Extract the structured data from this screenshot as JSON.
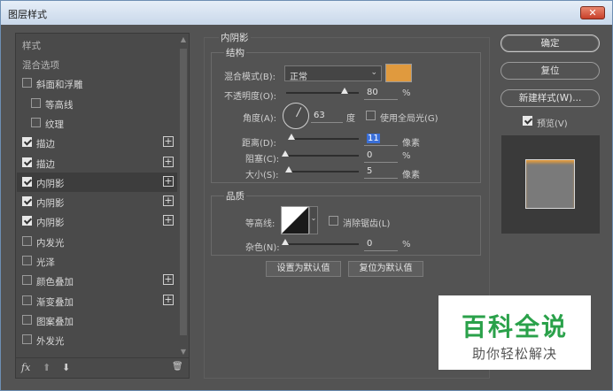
{
  "window": {
    "title": "图层样式",
    "close_glyph": "✕"
  },
  "left_panel": {
    "header": "样式",
    "items": [
      {
        "label": "混合选项",
        "has_checkbox": false,
        "checked": false,
        "selected": false,
        "has_plus": false,
        "indent": 0
      },
      {
        "label": "斜面和浮雕",
        "has_checkbox": true,
        "checked": false,
        "selected": false,
        "has_plus": false,
        "indent": 0
      },
      {
        "label": "等高线",
        "has_checkbox": true,
        "checked": false,
        "selected": false,
        "has_plus": false,
        "indent": 1
      },
      {
        "label": "纹理",
        "has_checkbox": true,
        "checked": false,
        "selected": false,
        "has_plus": false,
        "indent": 1
      },
      {
        "label": "描边",
        "has_checkbox": true,
        "checked": true,
        "selected": false,
        "has_plus": true,
        "indent": 0
      },
      {
        "label": "描边",
        "has_checkbox": true,
        "checked": true,
        "selected": false,
        "has_plus": true,
        "indent": 0
      },
      {
        "label": "内阴影",
        "has_checkbox": true,
        "checked": true,
        "selected": true,
        "has_plus": true,
        "indent": 0
      },
      {
        "label": "内阴影",
        "has_checkbox": true,
        "checked": true,
        "selected": false,
        "has_plus": true,
        "indent": 0
      },
      {
        "label": "内阴影",
        "has_checkbox": true,
        "checked": true,
        "selected": false,
        "has_plus": true,
        "indent": 0
      },
      {
        "label": "内发光",
        "has_checkbox": true,
        "checked": false,
        "selected": false,
        "has_plus": false,
        "indent": 0
      },
      {
        "label": "光泽",
        "has_checkbox": true,
        "checked": false,
        "selected": false,
        "has_plus": false,
        "indent": 0
      },
      {
        "label": "颜色叠加",
        "has_checkbox": true,
        "checked": false,
        "selected": false,
        "has_plus": true,
        "indent": 0
      },
      {
        "label": "渐变叠加",
        "has_checkbox": true,
        "checked": false,
        "selected": false,
        "has_plus": true,
        "indent": 0
      },
      {
        "label": "图案叠加",
        "has_checkbox": true,
        "checked": false,
        "selected": false,
        "has_plus": false,
        "indent": 0
      },
      {
        "label": "外发光",
        "has_checkbox": true,
        "checked": false,
        "selected": false,
        "has_plus": false,
        "indent": 0
      }
    ],
    "plus_glyph": "+",
    "bottom": {
      "fx": "fx",
      "up": "⬆",
      "down": "⬇",
      "trash": "🗑"
    }
  },
  "inner_shadow": {
    "section_title": "内阴影",
    "structure_title": "结构",
    "blend_mode_label": "混合模式(B):",
    "blend_mode_value": "正常",
    "shadow_color": "#e09a3e",
    "opacity_label": "不透明度(O):",
    "opacity_value": "80",
    "opacity_fraction": 0.8,
    "percent": "%",
    "angle_label": "角度(A):",
    "angle_value": "63",
    "angle_unit": "度",
    "global_light_label": "使用全局光(G)",
    "global_light_checked": false,
    "distance_label": "距离(D):",
    "distance_value": "11",
    "distance_fraction": 0.03,
    "choke_label": "阻塞(C):",
    "choke_value": "0",
    "choke_fraction": 0.0,
    "size_label": "大小(S):",
    "size_value": "5",
    "size_fraction": 0.02,
    "pixel_unit": "像素",
    "quality_title": "品质",
    "contour_label": "等高线:",
    "antialias_label": "消除锯齿(L)",
    "antialias_checked": false,
    "noise_label": "杂色(N):",
    "noise_value": "0",
    "noise_fraction": 0.0,
    "set_default_label": "设置为默认值",
    "reset_default_label": "复位为默认值"
  },
  "actions": {
    "ok_label": "确定",
    "reset_label": "复位",
    "new_style_label": "新建样式(W)...",
    "preview_label": "预览(V)",
    "preview_checked": true,
    "preview_accent": "#e09a3e"
  },
  "watermark": {
    "title": "百科全说",
    "subtitle": "助你轻松解决",
    "title_color": "#2aa14a"
  }
}
